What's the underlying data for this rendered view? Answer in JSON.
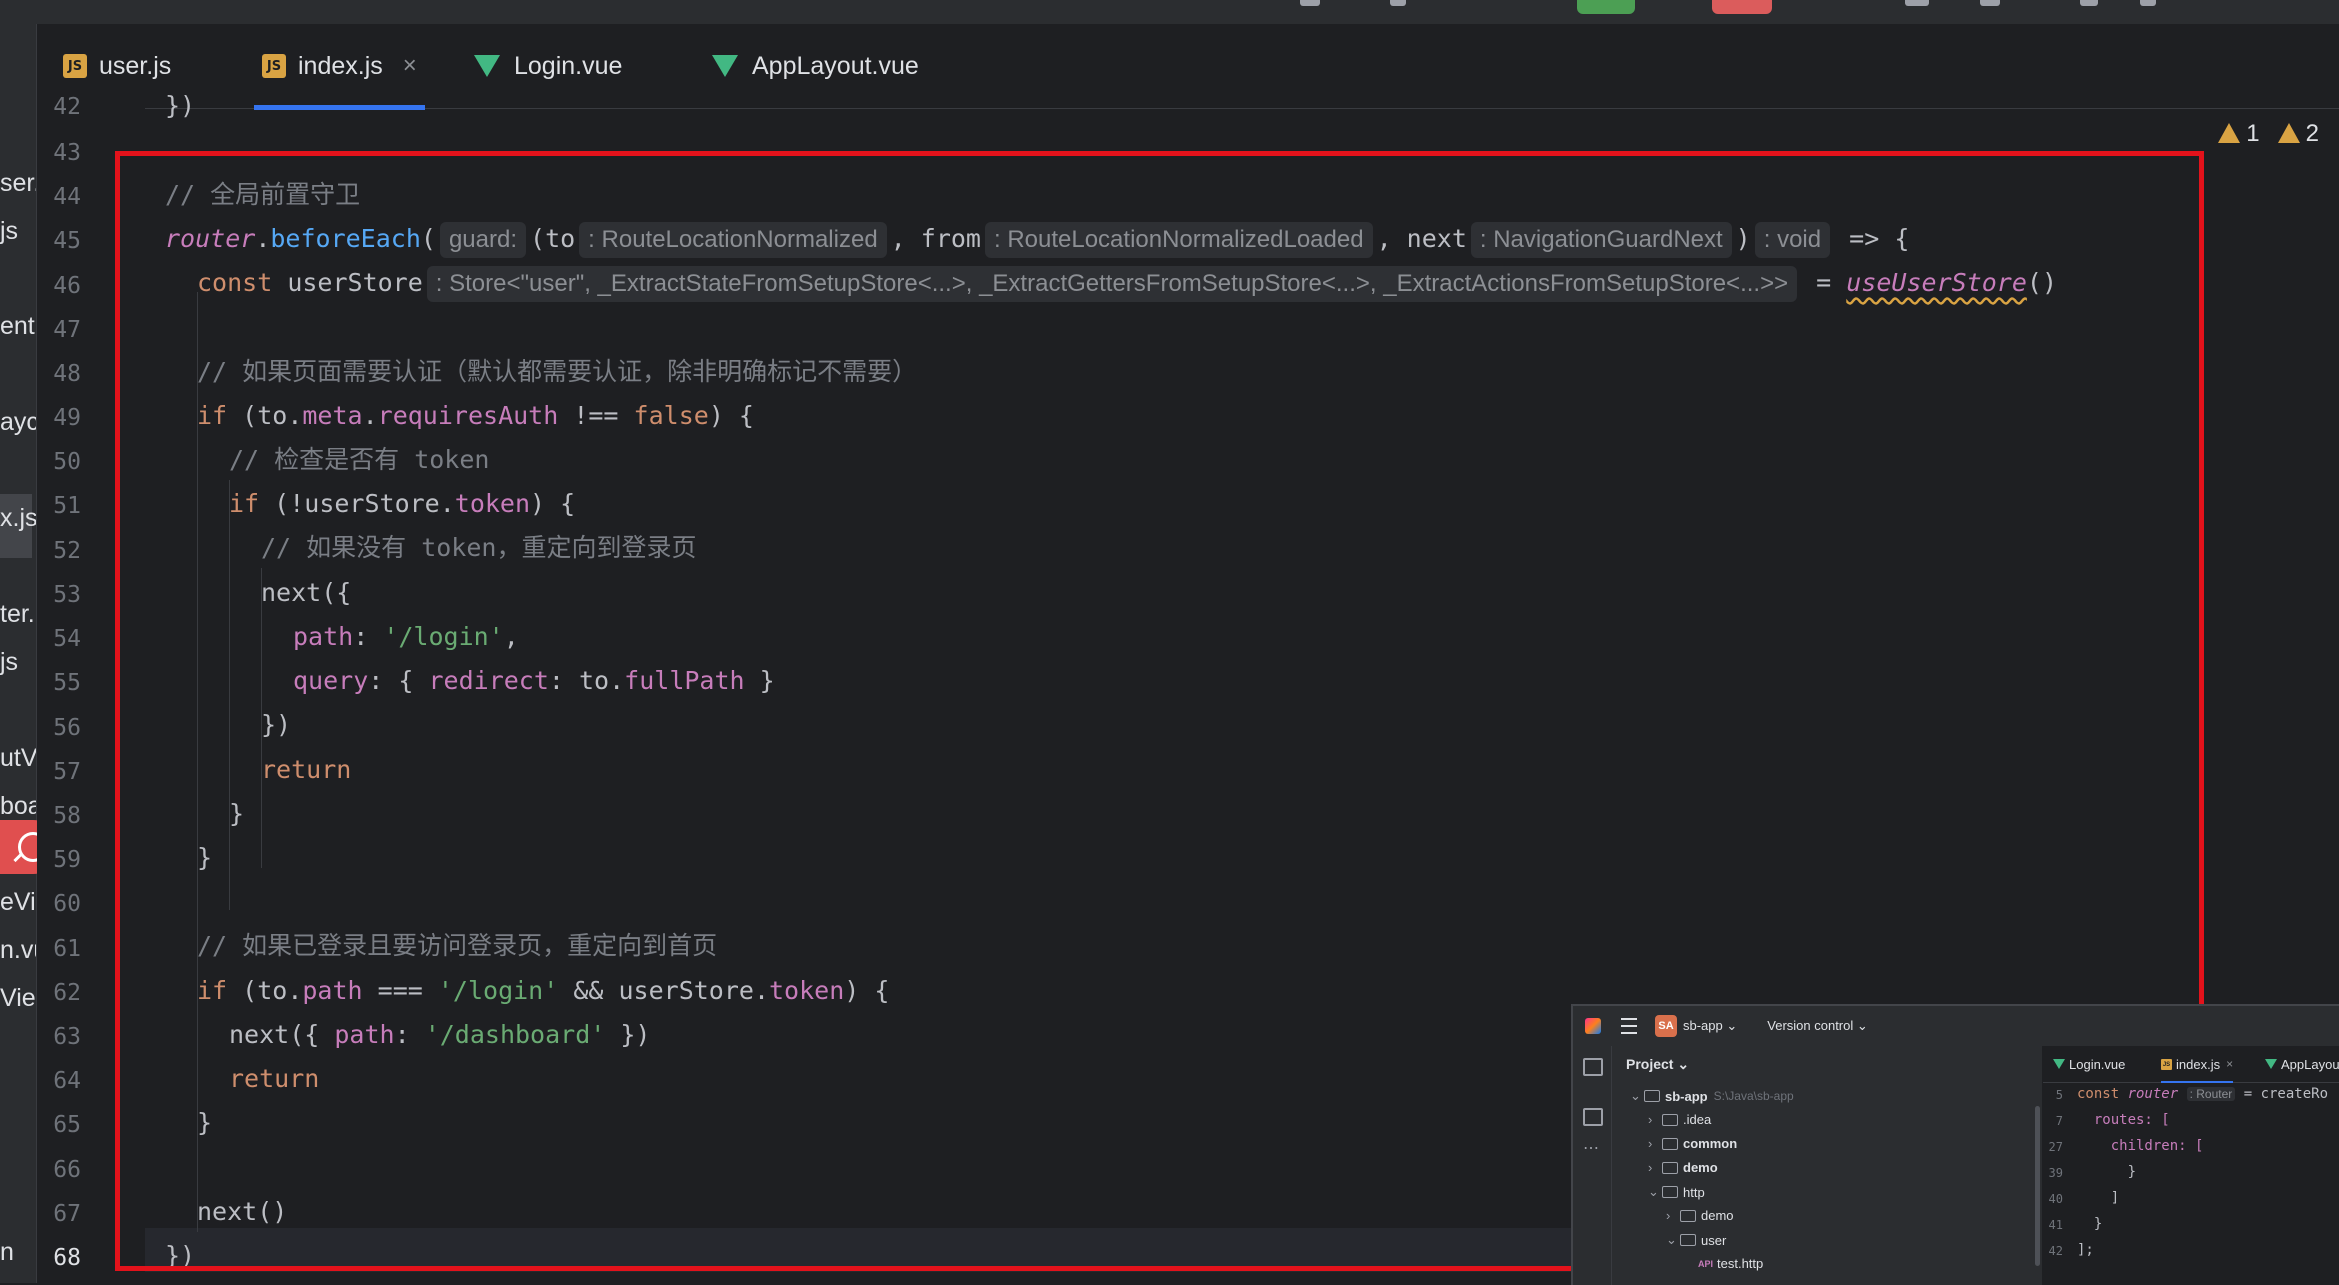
{
  "tabs": [
    {
      "label": "user.js",
      "icon": "js-file-icon",
      "active": false
    },
    {
      "label": "index.js",
      "icon": "js-file-icon",
      "active": true,
      "close": "×"
    },
    {
      "label": "Login.vue",
      "icon": "vue-file-icon",
      "active": false
    },
    {
      "label": "AppLayout.vue",
      "icon": "vue-file-icon",
      "active": false
    }
  ],
  "left_panel_fragments": [
    "ser.",
    "js",
    "ent",
    "ayc",
    "x.js",
    "ter.",
    "js",
    "utVi",
    "boa",
    "eVi",
    "n.vu",
    "Vie",
    "n"
  ],
  "inspections": {
    "warnings": "1",
    "weak_warnings": "2"
  },
  "line_numbers": [
    "42",
    "43",
    "44",
    "45",
    "46",
    "47",
    "48",
    "49",
    "50",
    "51",
    "52",
    "53",
    "54",
    "55",
    "56",
    "57",
    "58",
    "59",
    "60",
    "61",
    "62",
    "63",
    "64",
    "65",
    "66",
    "67",
    "68"
  ],
  "code": {
    "l42": "})",
    "l44_comment": "// 全局前置守卫",
    "l45_router": "router",
    "l45_dot": ".",
    "l45_fn": "beforeEach",
    "l45_paren": "(",
    "l45_hint_guard": "guard:",
    "l45_to": "(to",
    "l45_hint_to": ": RouteLocationNormalized",
    "l45_comma1": ", from",
    "l45_hint_from": ": RouteLocationNormalizedLoaded",
    "l45_comma2": ", next",
    "l45_hint_next": ": NavigationGuardNext",
    "l45_close": ")",
    "l45_hint_void": ": void",
    "l45_arrow": " => {",
    "l46_const": "const",
    "l46_var": " userStore",
    "l46_hint": ": Store<\"user\", _ExtractStateFromSetupStore<...>, _ExtractGettersFromSetupStore<...>, _ExtractActionsFromSetupStore<...>>",
    "l46_eq": " = ",
    "l46_call": "useUserStore",
    "l46_parens": "()",
    "l48_comment": "// 如果页面需要认证（默认都需要认证，除非明确标记不需要）",
    "l49_if": "if",
    "l49_a": " (to.",
    "l49_meta": "meta",
    "l49_dot": ".",
    "l49_req": "requiresAuth",
    "l49_b": " !== ",
    "l49_false": "false",
    "l49_c": ") {",
    "l50_comment": "// 检查是否有 token",
    "l51_if": "if",
    "l51_a": " (!userStore.",
    "l51_token": "token",
    "l51_b": ") {",
    "l52_comment": "// 如果没有 token，重定向到登录页",
    "l53": "next({",
    "l54_key": "path",
    "l54_colon": ": ",
    "l54_val": "'/login'",
    "l54_comma": ",",
    "l55_key": "query",
    "l55_a": ": { ",
    "l55_key2": "redirect",
    "l55_b": ": to.",
    "l55_full": "fullPath",
    "l55_c": " }",
    "l56": "})",
    "l57_return": "return",
    "l58": "}",
    "l59": "}",
    "l61_comment": "// 如果已登录且要访问登录页，重定向到首页",
    "l62_if": "if",
    "l62_a": " (to.",
    "l62_path": "path",
    "l62_b": " === ",
    "l62_str": "'/login'",
    "l62_c": " && userStore.",
    "l62_token": "token",
    "l62_d": ") {",
    "l63_a": "next({ ",
    "l63_key": "path",
    "l63_b": ": ",
    "l63_str": "'/dashboard'",
    "l63_c": " })",
    "l64_return": "return",
    "l65": "}",
    "l67": "next()",
    "l68": "})"
  },
  "mini_ide": {
    "project_badge": "SA",
    "project_name": "sb-app ⌄",
    "version_control": "Version control ⌄",
    "project_label": "Project ⌄",
    "tree": [
      {
        "name": "sb-app",
        "path": "S:\\Java\\sb-app",
        "chev": "⌄"
      },
      {
        "name": ".idea",
        "chev": "›"
      },
      {
        "name": "common",
        "chev": "›"
      },
      {
        "name": "demo",
        "chev": "›"
      },
      {
        "name": "http",
        "chev": "⌄"
      },
      {
        "name": "demo",
        "chev": "›"
      },
      {
        "name": "user",
        "chev": "⌄"
      },
      {
        "name": "test.http",
        "chev": ""
      }
    ],
    "api_tag": "API",
    "tabs": [
      "Login.vue",
      "index.js",
      "AppLayout.vue"
    ],
    "tab_close": "×",
    "code_lines": [
      {
        "n": "5",
        "a": "const ",
        "b": "router",
        "hint": ": Router",
        "c": " = createRo"
      },
      {
        "n": "7",
        "a": "  routes: ["
      },
      {
        "n": "27",
        "a": "    children: ["
      },
      {
        "n": "39",
        "a": "      }"
      },
      {
        "n": "40",
        "a": "    ]"
      },
      {
        "n": "41",
        "a": "  }"
      },
      {
        "n": "42",
        "a": "];"
      }
    ]
  }
}
